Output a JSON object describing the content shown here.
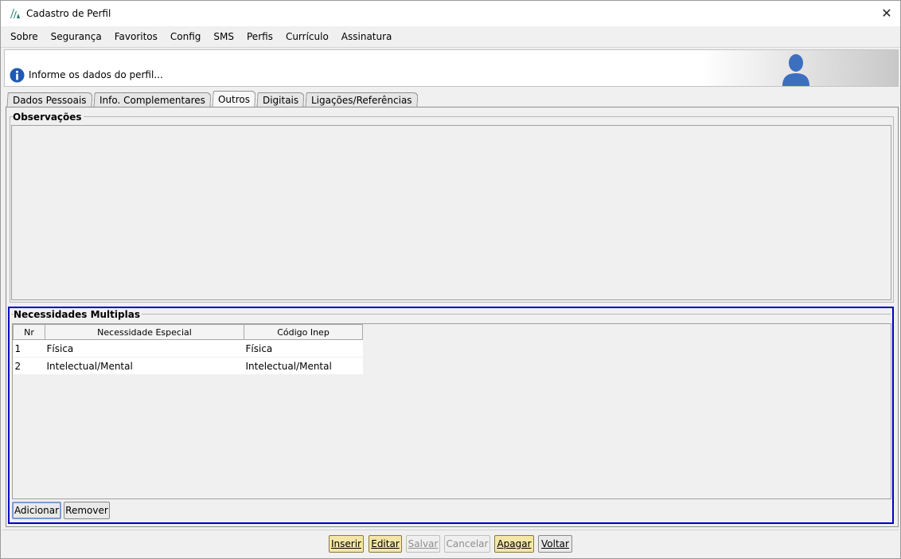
{
  "window": {
    "title": "Cadastro de Perfil",
    "close_symbol": "✕"
  },
  "menu": [
    {
      "label": "Sobre"
    },
    {
      "label": "Segurança"
    },
    {
      "label": "Favoritos"
    },
    {
      "label": "Config"
    },
    {
      "label": "SMS"
    },
    {
      "label": "Perfis"
    },
    {
      "label": "Currículo"
    },
    {
      "label": "Assinatura"
    }
  ],
  "header": {
    "message": "Informe os dados do perfil...",
    "icons": [
      "info-icon",
      "user-avatar-icon"
    ]
  },
  "tabs": [
    {
      "label": "Dados Pessoais",
      "active": false
    },
    {
      "label": "Info. Complementares",
      "active": false
    },
    {
      "label": "Outros",
      "active": true
    },
    {
      "label": "Digitais",
      "active": false
    },
    {
      "label": "Ligações/Referências",
      "active": false
    }
  ],
  "observacoes": {
    "label": "Observações",
    "value": ""
  },
  "necessidades": {
    "label": "Necessidades Multiplas",
    "columns": [
      "Nr",
      "Necessidade Especial",
      "Código Inep"
    ],
    "rows": [
      {
        "nr": "1",
        "necessidade": "Física",
        "codigo": "Física"
      },
      {
        "nr": "2",
        "necessidade": "Intelectual/Mental",
        "codigo": "Intelectual/Mental"
      }
    ],
    "add_label": "Adicionar",
    "remove_label": "Remover"
  },
  "actions": {
    "inserir": "Inserir",
    "editar": "Editar",
    "salvar": "Salvar",
    "cancelar": "Cancelar",
    "apagar": "Apagar",
    "voltar": "Voltar"
  },
  "colors": {
    "focus_border": "#0000c8",
    "highlight_button": "#f4e6a6",
    "info_blue": "#1e5ab4",
    "avatar_blue": "#3d6fc0"
  }
}
